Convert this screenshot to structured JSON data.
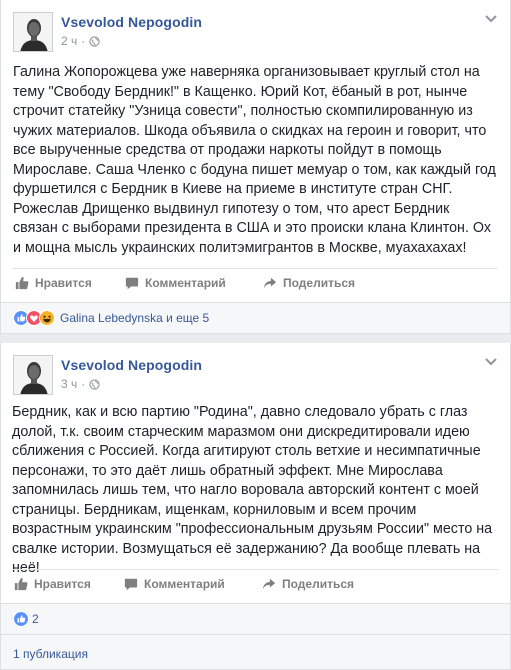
{
  "posts": [
    {
      "author": "Vsevolod Nepogodin",
      "time": "2 ч",
      "text": "Галина Жопорожцева уже наверняка организовывает круглый стол на тему \"Свободу Бердник!\" в Кащенко. Юрий Кот, ёбаный в рот, нынче строчит статейку \"Узница совести\", полностью скомпилированную из чужих материалов. Шкода объявила о скидках на героин и говорит, что все вырученные средства от продажи наркоты пойдут в помощь Мирославе. Саша Членко с бодуна пишет мемуар о том, как каждый год фуршетился с Бердник в Киеве на приеме в институте стран СНГ. Рожеслав Дрищенко выдвинул гипотезу о том, что арест Бердник связан с выборами президента в США и это происки клана Клинтон. Ох и мощна мысль украинских политэмигрантов в Москве, муахахахах!",
      "actions": {
        "like": "Нравится",
        "comment": "Комментарий",
        "share": "Поделиться"
      },
      "reactions_text": "Galina Lebedynska и еще 5"
    },
    {
      "author": "Vsevolod Nepogodin",
      "time": "3 ч",
      "text": "Бердник, как и всю партию \"Родина\", давно следовало убрать с глаз долой, т.к. своим старческим маразмом они дискредитировали идею сближения с Россией. Когда агитируют столь ветхие и несимпатичные персонажи, то это даёт лишь обратный эффект. Мне Мирославa запомнилась лишь тем, что нагло воровала авторский контент с моей страницы. Бердникам, ищенкам, корниловым и всем прочим возрастным украинским \"профессиональным друзьям России\" место на свалке истории. Возмущаться её задержанию? Да вообще плевать на неё!",
      "actions": {
        "like": "Нравится",
        "comment": "Комментарий",
        "share": "Поделиться"
      },
      "reactions_text": "2"
    }
  ],
  "footer": {
    "label": "1 публикация"
  },
  "colors": {
    "link": "#365899",
    "like_blue": "#5890ff",
    "love_red": "#f25268",
    "haha_yellow": "#f7b125"
  }
}
